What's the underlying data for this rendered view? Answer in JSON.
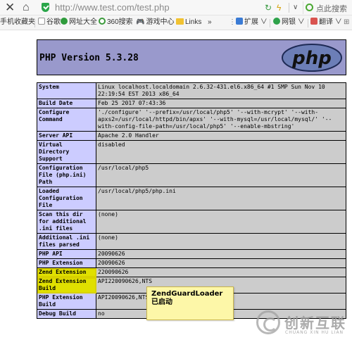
{
  "browser": {
    "url": "http://www.test.com/test.php",
    "search_hint": "点此搜索",
    "bookmarks": [
      {
        "label": "手机收藏夹",
        "icon": "phone-icon"
      },
      {
        "label": "谷歌",
        "icon": "page-icon"
      },
      {
        "label": "网址大全",
        "icon": "site-icon"
      },
      {
        "label": "360搜索",
        "icon": "search-360-icon"
      },
      {
        "label": "游戏中心",
        "icon": "gamepad-icon"
      },
      {
        "label": "Links",
        "icon": "folder-icon"
      },
      {
        "label": "»",
        "icon": ""
      },
      {
        "label": "扩展",
        "icon": "grid-icon"
      },
      {
        "label": "网银",
        "icon": "bank-icon"
      },
      {
        "label": "翻译",
        "icon": "translate-icon"
      }
    ]
  },
  "phpinfo": {
    "version_title": "PHP Version 5.3.28",
    "logo_text": "php",
    "rows": [
      {
        "key": "System",
        "value": "Linux localhost.localdomain 2.6.32-431.el6.x86_64 #1 SMP Sun Nov 10 22:19:54 EST 2013 x86_64"
      },
      {
        "key": "Build Date",
        "value": "Feb 25 2017 07:43:36"
      },
      {
        "key": "Configure Command",
        "value": "'./configure' '--prefix=/usr/local/php5' '--with-mcrypt' '--with-apxs2=/usr/local/httpd/bin/apxs' '--with-mysql=/usr/local/mysql/' '--with-config-file-path=/usr/local/php5' '--enable-mbstring'"
      },
      {
        "key": "Server API",
        "value": "Apache 2.0 Handler"
      },
      {
        "key": "Virtual Directory Support",
        "value": "disabled"
      },
      {
        "key": "Configuration File (php.ini) Path",
        "value": "/usr/local/php5"
      },
      {
        "key": "Loaded Configuration File",
        "value": "/usr/local/php5/php.ini"
      },
      {
        "key": "Scan this dir for additional .ini files",
        "value": "(none)"
      },
      {
        "key": "Additional .ini files parsed",
        "value": "(none)"
      },
      {
        "key": "PHP API",
        "value": "20090626"
      },
      {
        "key": "PHP Extension",
        "value": "20090626"
      },
      {
        "key": "Zend Extension",
        "value": "220090626"
      },
      {
        "key": "Zend Extension Build",
        "value": "API220090626,NTS"
      },
      {
        "key": "PHP Extension Build",
        "value": "API20090626,NTS"
      },
      {
        "key": "Debug Build",
        "value": "no"
      }
    ]
  },
  "annotation": {
    "text": "ZendGuardLoader已启动"
  },
  "watermark": {
    "cn": "创新互联",
    "en": "CHUANG XIN HU LIAN"
  },
  "colors": {
    "header_bg": "#9999cc",
    "key_bg": "#ccccff",
    "value_bg": "#cccccc",
    "highlight": "#e0e000",
    "tooltip_bg": "#fdf7a8"
  }
}
